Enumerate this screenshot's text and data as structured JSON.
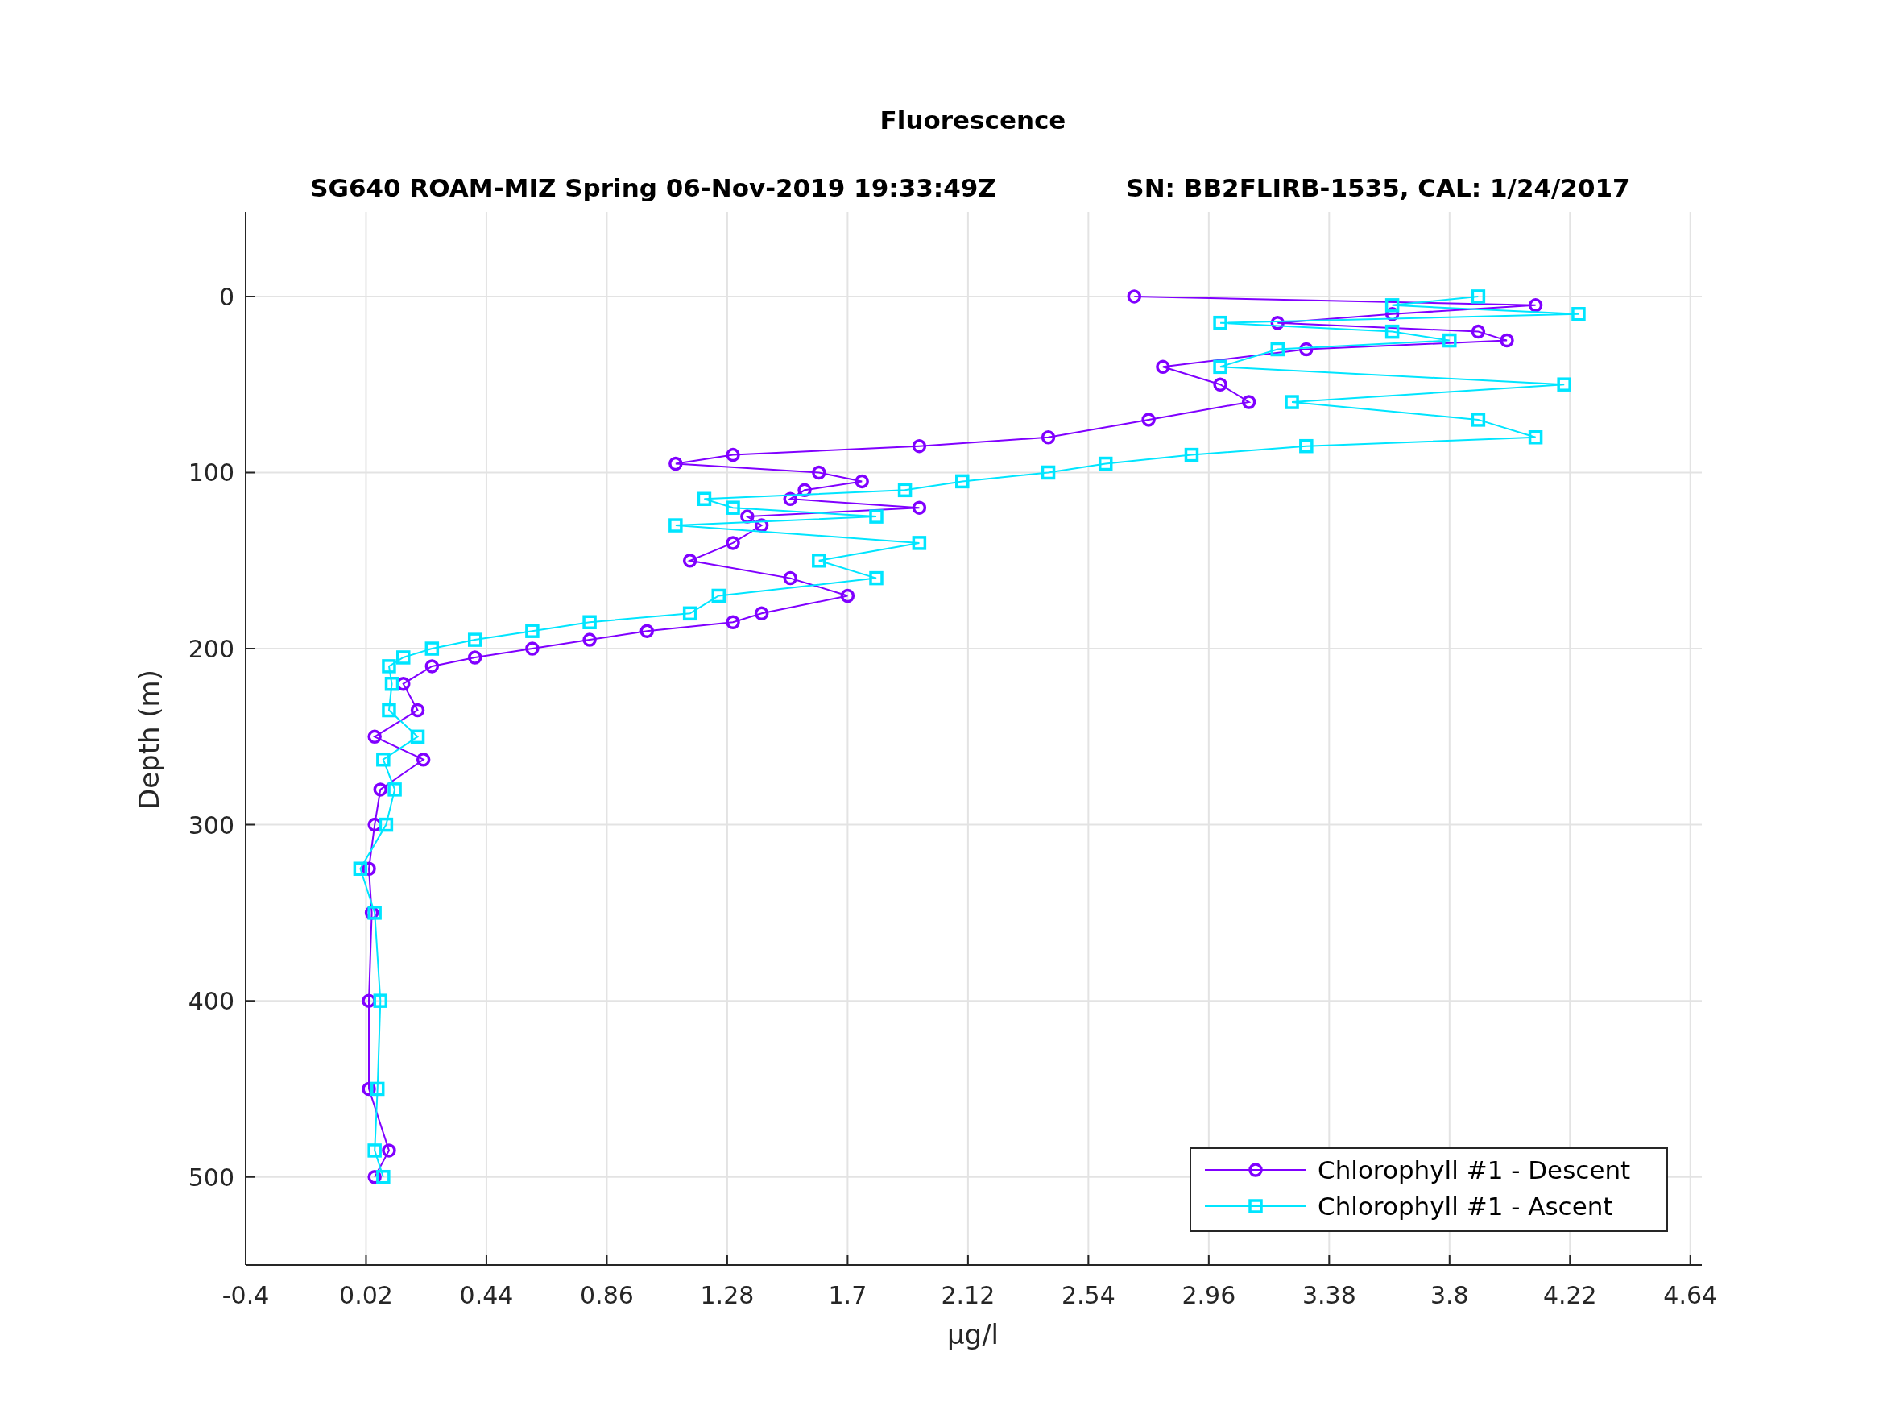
{
  "figure": {
    "title": "Fluorescence",
    "subtitle_left": "SG640 ROAM-MIZ Spring 06-Nov-2019 19:33:49Z",
    "subtitle_right": "SN: BB2FLIRB-1535, CAL: 1/24/2017"
  },
  "chart_data": {
    "type": "line",
    "orientation": "horizontal",
    "xlabel": "μg/l",
    "ylabel": "Depth (m)",
    "x": [
      0,
      5,
      10,
      15,
      20,
      25,
      30,
      40,
      50,
      60,
      70,
      80,
      85,
      90,
      95,
      100,
      105,
      110,
      115,
      120,
      125,
      130,
      140,
      150,
      160,
      170,
      180,
      185,
      190,
      195,
      200,
      205,
      210,
      220,
      235,
      250,
      263,
      280,
      300,
      325,
      350,
      400,
      450,
      485,
      500
    ],
    "series": [
      {
        "name": "Chlorophyll #1 - Descent",
        "color": "#8000ff",
        "marker": "circle",
        "values": [
          2.7,
          4.1,
          3.6,
          3.2,
          3.9,
          4.0,
          3.3,
          2.8,
          3.0,
          3.1,
          2.75,
          2.4,
          1.95,
          1.3,
          1.1,
          1.6,
          1.75,
          1.55,
          1.5,
          1.95,
          1.35,
          1.4,
          1.3,
          1.15,
          1.5,
          1.7,
          1.4,
          1.3,
          1.0,
          0.8,
          0.6,
          0.4,
          0.25,
          0.15,
          0.2,
          0.05,
          0.22,
          0.07,
          0.05,
          0.03,
          0.04,
          0.03,
          0.03,
          0.1,
          0.05
        ]
      },
      {
        "name": "Chlorophyll #1 - Ascent",
        "color": "#00e5ff",
        "marker": "square",
        "values": [
          3.9,
          3.6,
          4.25,
          3.0,
          3.6,
          3.8,
          3.2,
          3.0,
          4.2,
          3.25,
          3.9,
          4.1,
          3.3,
          2.9,
          2.6,
          2.4,
          2.1,
          1.9,
          1.2,
          1.3,
          1.8,
          1.1,
          1.95,
          1.6,
          1.8,
          1.25,
          1.15,
          0.8,
          0.6,
          0.4,
          0.25,
          0.15,
          0.1,
          0.11,
          0.1,
          0.2,
          0.08,
          0.12,
          0.09,
          0.0,
          0.05,
          0.07,
          0.06,
          0.05,
          0.08
        ]
      }
    ],
    "xlim": [
      -0.4,
      4.68
    ],
    "ylim": [
      550,
      -48
    ],
    "grid": true,
    "legend": true,
    "xticks": [
      -0.4,
      0.02,
      0.44,
      0.86,
      1.28,
      1.7,
      2.12,
      2.54,
      2.96,
      3.38,
      3.8,
      4.22,
      4.64
    ],
    "yticks": [
      0,
      100,
      200,
      300,
      400,
      500
    ]
  }
}
